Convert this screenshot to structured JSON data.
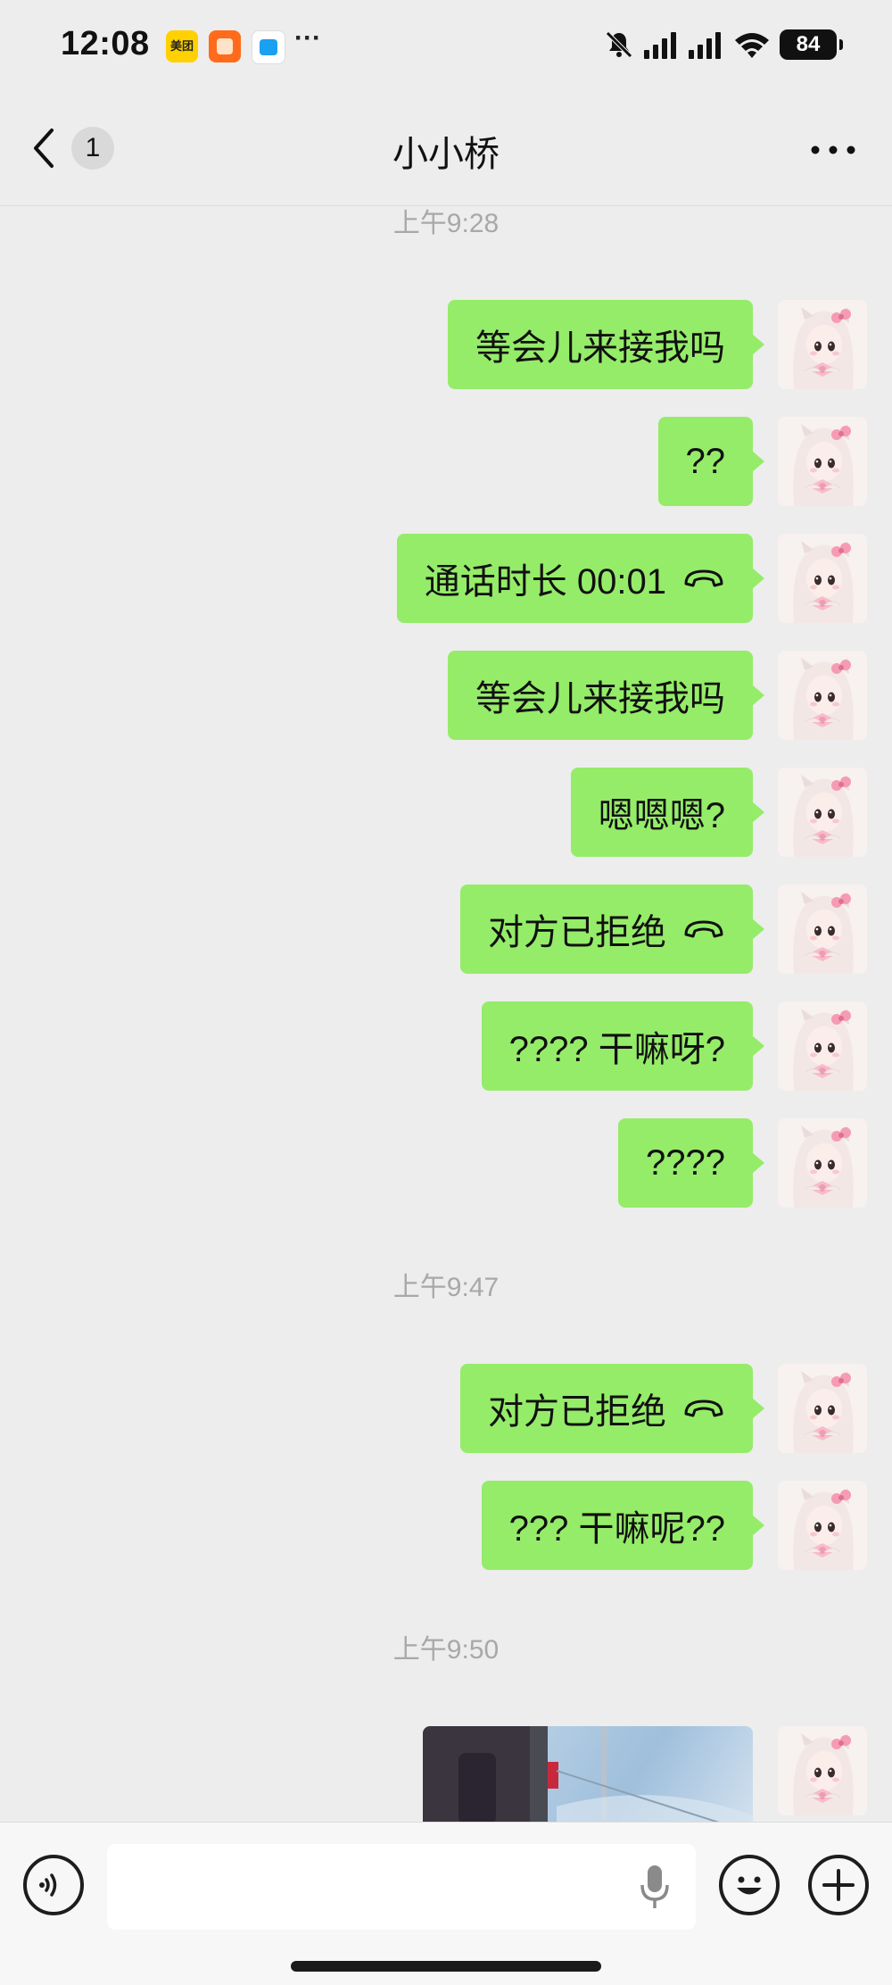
{
  "status_bar": {
    "time": "12:08",
    "app_meituan": "美团",
    "more": "···",
    "battery": "84"
  },
  "nav": {
    "unread_count": "1",
    "title": "小小桥"
  },
  "timestamps": [
    "上午9:28",
    "上午9:47",
    "上午9:50"
  ],
  "messages": [
    {
      "text": "等会儿来接我吗",
      "call": false
    },
    {
      "text": "??",
      "call": false
    },
    {
      "text": "通话时长 00:01",
      "call": true
    },
    {
      "text": "等会儿来接我吗",
      "call": false
    },
    {
      "text": "嗯嗯嗯?",
      "call": false
    },
    {
      "text": "对方已拒绝",
      "call": true
    },
    {
      "text": "???? 干嘛呀?",
      "call": false
    },
    {
      "text": "????",
      "call": false
    },
    {
      "text": "对方已拒绝",
      "call": true
    },
    {
      "text": "??? 干嘛呢??",
      "call": false
    }
  ],
  "input": {
    "placeholder": ""
  },
  "colors": {
    "bubble": "#95ec69",
    "background": "#ededed",
    "timestamp": "#a8a8a8"
  },
  "icons": [
    "back-icon",
    "more-icon",
    "voice-icon",
    "mic-icon",
    "emoji-icon",
    "plus-icon",
    "call-icon"
  ]
}
